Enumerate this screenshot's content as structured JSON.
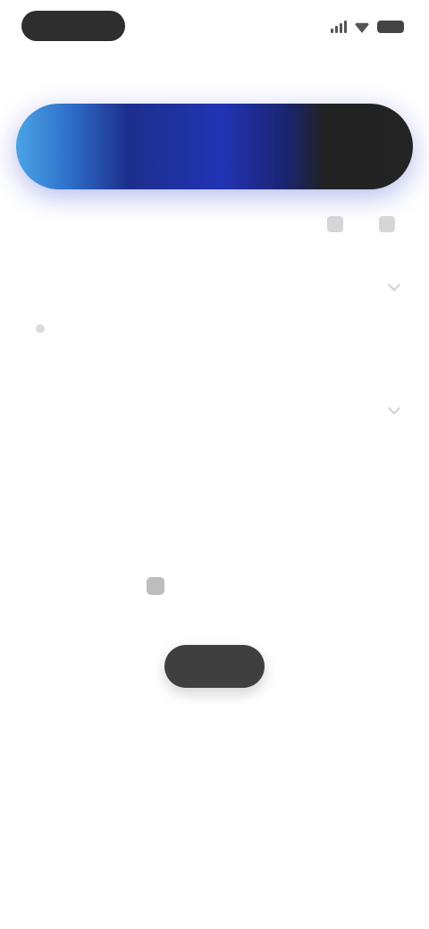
{
  "status_bar": {
    "time": "",
    "icons": [
      "signal-icon",
      "wifi-icon",
      "battery-icon"
    ]
  },
  "subtitle": "",
  "banner": {
    "label": "",
    "gradient_colors": [
      "#4aa3e6",
      "#1c2f8c",
      "#2133b3",
      "#242424"
    ]
  },
  "meta": {
    "text": "",
    "icons": [
      "share-icon",
      "more-icon"
    ]
  },
  "sections": [
    {
      "title": "",
      "items": [
        {
          "label": "",
          "sub": ""
        }
      ]
    },
    {
      "title": ""
    }
  ],
  "empty_state": {
    "text": "",
    "button_label": ""
  },
  "colors": {
    "accent": "#2133b3",
    "dark": "#2e2e2e"
  }
}
